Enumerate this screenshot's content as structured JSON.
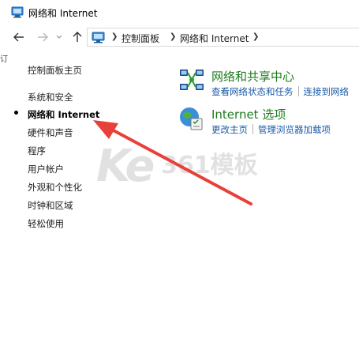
{
  "window": {
    "title": "网络和 Internet"
  },
  "address_bar": {
    "breadcrumbs": [
      "控制面板",
      "网络和 Internet"
    ]
  },
  "left_edge_glyph": "订",
  "sidebar": {
    "items": [
      {
        "label": "控制面板主页"
      },
      {
        "label": "系统和安全"
      },
      {
        "label": "网络和 Internet",
        "active": true
      },
      {
        "label": "硬件和声音"
      },
      {
        "label": "程序"
      },
      {
        "label": "用户帐户"
      },
      {
        "label": "外观和个性化"
      },
      {
        "label": "时钟和区域"
      },
      {
        "label": "轻松使用"
      }
    ]
  },
  "categories": [
    {
      "title": "网络和共享中心",
      "icon": "network-sharing-center-icon",
      "links": [
        "查看网络状态和任务",
        "连接到网络"
      ]
    },
    {
      "title": "Internet 选项",
      "icon": "internet-options-icon",
      "links": [
        "更改主页",
        "管理浏览器加载项"
      ]
    }
  ],
  "watermark": {
    "ke": "Ke",
    "rest": "361模板"
  },
  "colors": {
    "link": "#1a5aa6",
    "category_title": "#1e7b1e",
    "annotation_arrow": "#e8403a"
  }
}
